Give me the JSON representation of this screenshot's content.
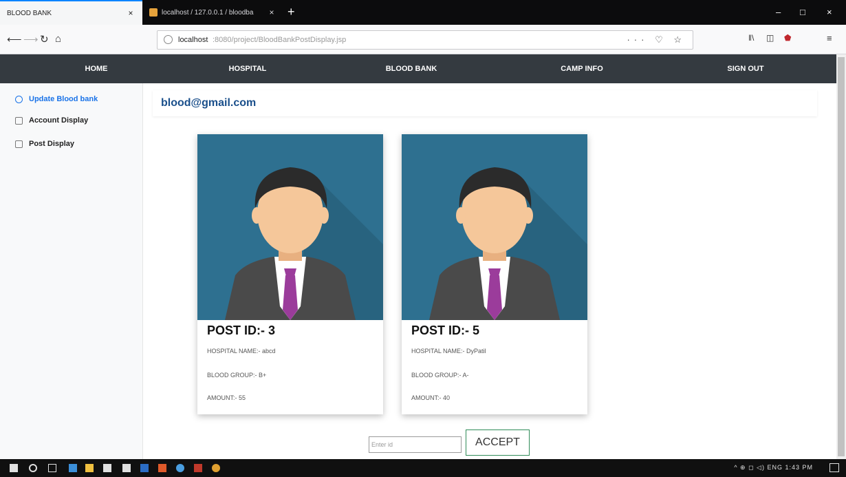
{
  "browser": {
    "active_tab_title": "BLOOD BANK",
    "inactive_tab_title": "localhost / 127.0.0.1 / bloodba",
    "tab_close": "×",
    "new_tab": "+",
    "url_host": "localhost",
    "url_path": ":8080/project/BloodBankPostDisplay.jsp",
    "url_actions": "··· ♡ ☆",
    "window_controls": [
      "–",
      "□",
      "×"
    ]
  },
  "nav": {
    "items": [
      "HOME",
      "HOSPITAL",
      "BLOOD BANK",
      "CAMP INFO",
      "SIGN OUT"
    ]
  },
  "sidebar": {
    "items": [
      {
        "label": "Update Blood bank",
        "color": "#1a73e8"
      },
      {
        "label": "Account Display",
        "color": "#222222"
      },
      {
        "label": "Post Display",
        "color": "#222222"
      }
    ]
  },
  "main": {
    "email": "blood@gmail.com",
    "posts": [
      {
        "post_id": "POST ID:- 3",
        "hospital": "HOSPITAL NAME:- abcd",
        "blood_group": "BLOOD GROUP:- B+",
        "amount": "AMOUNT:- 55"
      },
      {
        "post_id": "POST ID:- 5",
        "hospital": "HOSPITAL NAME:- DyPatil",
        "blood_group": "BLOOD GROUP:- A-",
        "amount": "AMOUNT:- 40"
      }
    ],
    "id_placeholder": "Enter id",
    "accept_label": "ACCEPT"
  },
  "taskbar": {
    "tray_text": "^ ⊕ ◻ ◁) ENG  1:43 PM"
  },
  "colors": {
    "navbar": "#343a40",
    "avatar_bg": "#2e7090",
    "suit": "#4a4a4a",
    "tie": "#9b3c9b",
    "skin": "#f5c79a",
    "hair": "#2b2b2b"
  }
}
